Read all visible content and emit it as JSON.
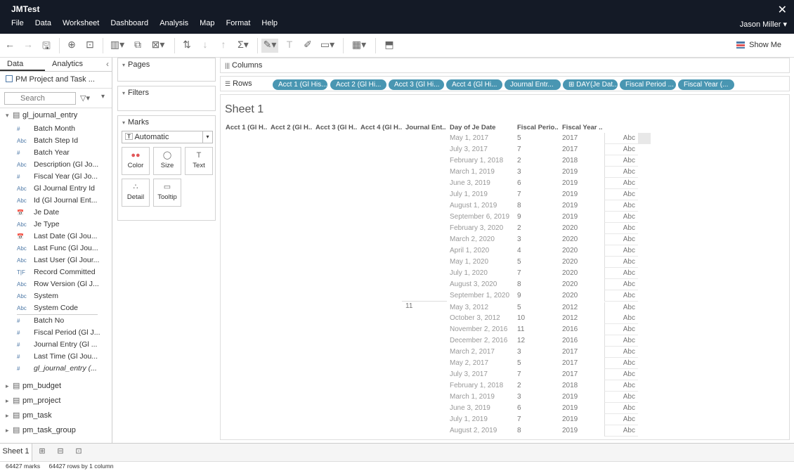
{
  "app": {
    "title": "JMTest",
    "user": "Jason Miller",
    "close": "✕"
  },
  "menu": [
    "File",
    "Data",
    "Worksheet",
    "Dashboard",
    "Analysis",
    "Map",
    "Format",
    "Help"
  ],
  "toolbar": {
    "show_me": "Show Me"
  },
  "datapane": {
    "tabs": [
      "Data",
      "Analytics"
    ],
    "source": "PM Project and Task ...",
    "search_placeholder": "Search",
    "table": "gl_journal_entry",
    "fields": [
      {
        "icon": "#",
        "label": "Batch Month"
      },
      {
        "icon": "Abc",
        "label": "Batch Step Id"
      },
      {
        "icon": "#",
        "label": "Batch Year"
      },
      {
        "icon": "Abc",
        "label": "Description (Gl Jo..."
      },
      {
        "icon": "#",
        "label": "Fiscal Year (Gl Jo..."
      },
      {
        "icon": "Abc",
        "label": "Gl Journal Entry Id"
      },
      {
        "icon": "Abc",
        "label": "Id (Gl Journal Ent..."
      },
      {
        "icon": "📅",
        "label": "Je Date"
      },
      {
        "icon": "Abc",
        "label": "Je Type"
      },
      {
        "icon": "📅",
        "label": "Last Date (Gl Jou..."
      },
      {
        "icon": "Abc",
        "label": "Last Func (Gl Jou..."
      },
      {
        "icon": "Abc",
        "label": "Last User (Gl Jour..."
      },
      {
        "icon": "T|F",
        "label": "Record Committed"
      },
      {
        "icon": "Abc",
        "label": "Row Version (Gl J..."
      },
      {
        "icon": "Abc",
        "label": "System"
      },
      {
        "icon": "Abc",
        "label": "System Code"
      }
    ],
    "measures": [
      {
        "icon": "#",
        "label": "Batch No"
      },
      {
        "icon": "#",
        "label": "Fiscal Period (Gl J..."
      },
      {
        "icon": "#",
        "label": "Journal Entry (Gl ..."
      },
      {
        "icon": "#",
        "label": "Last Time (Gl Jou..."
      },
      {
        "icon": "#",
        "label": "gl_journal_entry (..."
      }
    ],
    "other_tables": [
      "pm_budget",
      "pm_project",
      "pm_task",
      "pm_task_group"
    ]
  },
  "cards": {
    "pages": "Pages",
    "filters": "Filters",
    "marks": "Marks",
    "mark_type": "Automatic",
    "mark_buttons": [
      {
        "icon": "●●",
        "label": "Color"
      },
      {
        "icon": "◯",
        "label": "Size"
      },
      {
        "icon": "T",
        "label": "Text"
      },
      {
        "icon": "∴",
        "label": "Detail"
      },
      {
        "icon": "▭",
        "label": "Tooltip"
      }
    ]
  },
  "shelves": {
    "columns_label": "Columns",
    "rows_label": "Rows",
    "row_pills": [
      "Acct 1 (Gl His...",
      "Acct 2 (Gl Hi...",
      "Acct 3 (Gl Hi...",
      "Acct 4 (Gl Hi...",
      "Journal Entr...",
      "⊞ DAY(Je Dat...",
      "Fiscal Period ...",
      "Fiscal Year (..."
    ]
  },
  "sheet": {
    "title": "Sheet 1",
    "headers": [
      "Acct 1 (Gl H..",
      "Acct 2 (Gl H..",
      "Acct 3 (Gl H..",
      "Acct 4 (Gl H..",
      "Journal Ent..",
      "Day of Je Date",
      "Fiscal Perio..",
      "Fiscal Year .."
    ],
    "journal_value": "11",
    "rows": [
      [
        "May 1, 2017",
        "5",
        "2017",
        "Abc"
      ],
      [
        "July 3, 2017",
        "7",
        "2017",
        "Abc"
      ],
      [
        "February 1, 2018",
        "2",
        "2018",
        "Abc"
      ],
      [
        "March 1, 2019",
        "3",
        "2019",
        "Abc"
      ],
      [
        "June 3, 2019",
        "6",
        "2019",
        "Abc"
      ],
      [
        "July 1, 2019",
        "7",
        "2019",
        "Abc"
      ],
      [
        "August 1, 2019",
        "8",
        "2019",
        "Abc"
      ],
      [
        "September 6, 2019",
        "9",
        "2019",
        "Abc"
      ],
      [
        "February 3, 2020",
        "2",
        "2020",
        "Abc"
      ],
      [
        "March 2, 2020",
        "3",
        "2020",
        "Abc"
      ],
      [
        "April 1, 2020",
        "4",
        "2020",
        "Abc"
      ],
      [
        "May 1, 2020",
        "5",
        "2020",
        "Abc"
      ],
      [
        "July 1, 2020",
        "7",
        "2020",
        "Abc"
      ],
      [
        "August 3, 2020",
        "8",
        "2020",
        "Abc"
      ],
      [
        "September 1, 2020",
        "9",
        "2020",
        "Abc"
      ],
      [
        "May 3, 2012",
        "5",
        "2012",
        "Abc"
      ],
      [
        "October 3, 2012",
        "10",
        "2012",
        "Abc"
      ],
      [
        "November 2, 2016",
        "11",
        "2016",
        "Abc"
      ],
      [
        "December 2, 2016",
        "12",
        "2016",
        "Abc"
      ],
      [
        "March 2, 2017",
        "3",
        "2017",
        "Abc"
      ],
      [
        "May 2, 2017",
        "5",
        "2017",
        "Abc"
      ],
      [
        "July 3, 2017",
        "7",
        "2017",
        "Abc"
      ],
      [
        "February 1, 2018",
        "2",
        "2018",
        "Abc"
      ],
      [
        "March 1, 2019",
        "3",
        "2019",
        "Abc"
      ],
      [
        "June 3, 2019",
        "6",
        "2019",
        "Abc"
      ],
      [
        "July 1, 2019",
        "7",
        "2019",
        "Abc"
      ],
      [
        "August 2, 2019",
        "8",
        "2019",
        "Abc"
      ]
    ]
  },
  "sheet_tabs": {
    "active": "Sheet 1"
  },
  "status": {
    "marks": "64427 marks",
    "rows": "64427 rows by 1 column"
  }
}
